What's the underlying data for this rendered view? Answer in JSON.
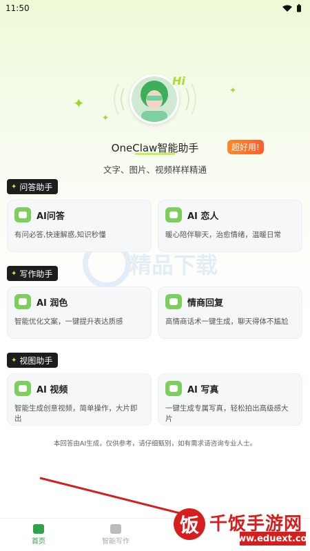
{
  "status": {
    "time": "11:50"
  },
  "hero": {
    "hi": "Hi",
    "title": "OneClaw智能助手",
    "badge": "超好用!",
    "subtitle": "文字、图片、视频样样精通"
  },
  "sections": [
    {
      "tag": "问答助手",
      "cards": [
        {
          "title": "AI问答",
          "desc": "有问必答,快速解惑,知识秒懂",
          "icon": "chat-icon"
        },
        {
          "title": "AI 恋人",
          "desc": "暖心陪伴聊天，治愈情绪，温暖日常",
          "icon": "lover-icon"
        }
      ]
    },
    {
      "tag": "写作助手",
      "cards": [
        {
          "title": "AI 润色",
          "desc": "智能优化文案，一键提升表达质感",
          "icon": "polish-icon"
        },
        {
          "title": "情商回复",
          "desc": "高情商话术一键生成，聊天得体不尴尬",
          "icon": "reply-icon"
        }
      ]
    },
    {
      "tag": "视图助手",
      "cards": [
        {
          "title": "AI 视频",
          "desc": "智能生成创意视频，简单操作，大片即出",
          "icon": "video-icon"
        },
        {
          "title": "AI 写真",
          "desc": "一键生成专属写真，轻松拍出高级感大片",
          "icon": "portrait-icon"
        }
      ]
    }
  ],
  "footer_note": "本回答由AI生成，仅供参考，请仔细甄别，如有需求请咨询专业人士。",
  "watermarks": {
    "center_text": "精品下载",
    "corner_cn": "千饭手游网",
    "corner_url": "www.eduext.com",
    "seal": "饭"
  },
  "bottom_nav": [
    {
      "label": "首页",
      "active": true
    },
    {
      "label": "智能写作",
      "active": false
    }
  ],
  "colors": {
    "accent": "#c7ee52",
    "active_nav": "#2fa24a",
    "badge": "#ff6a2b",
    "card_bg": "#f6f7f8"
  }
}
